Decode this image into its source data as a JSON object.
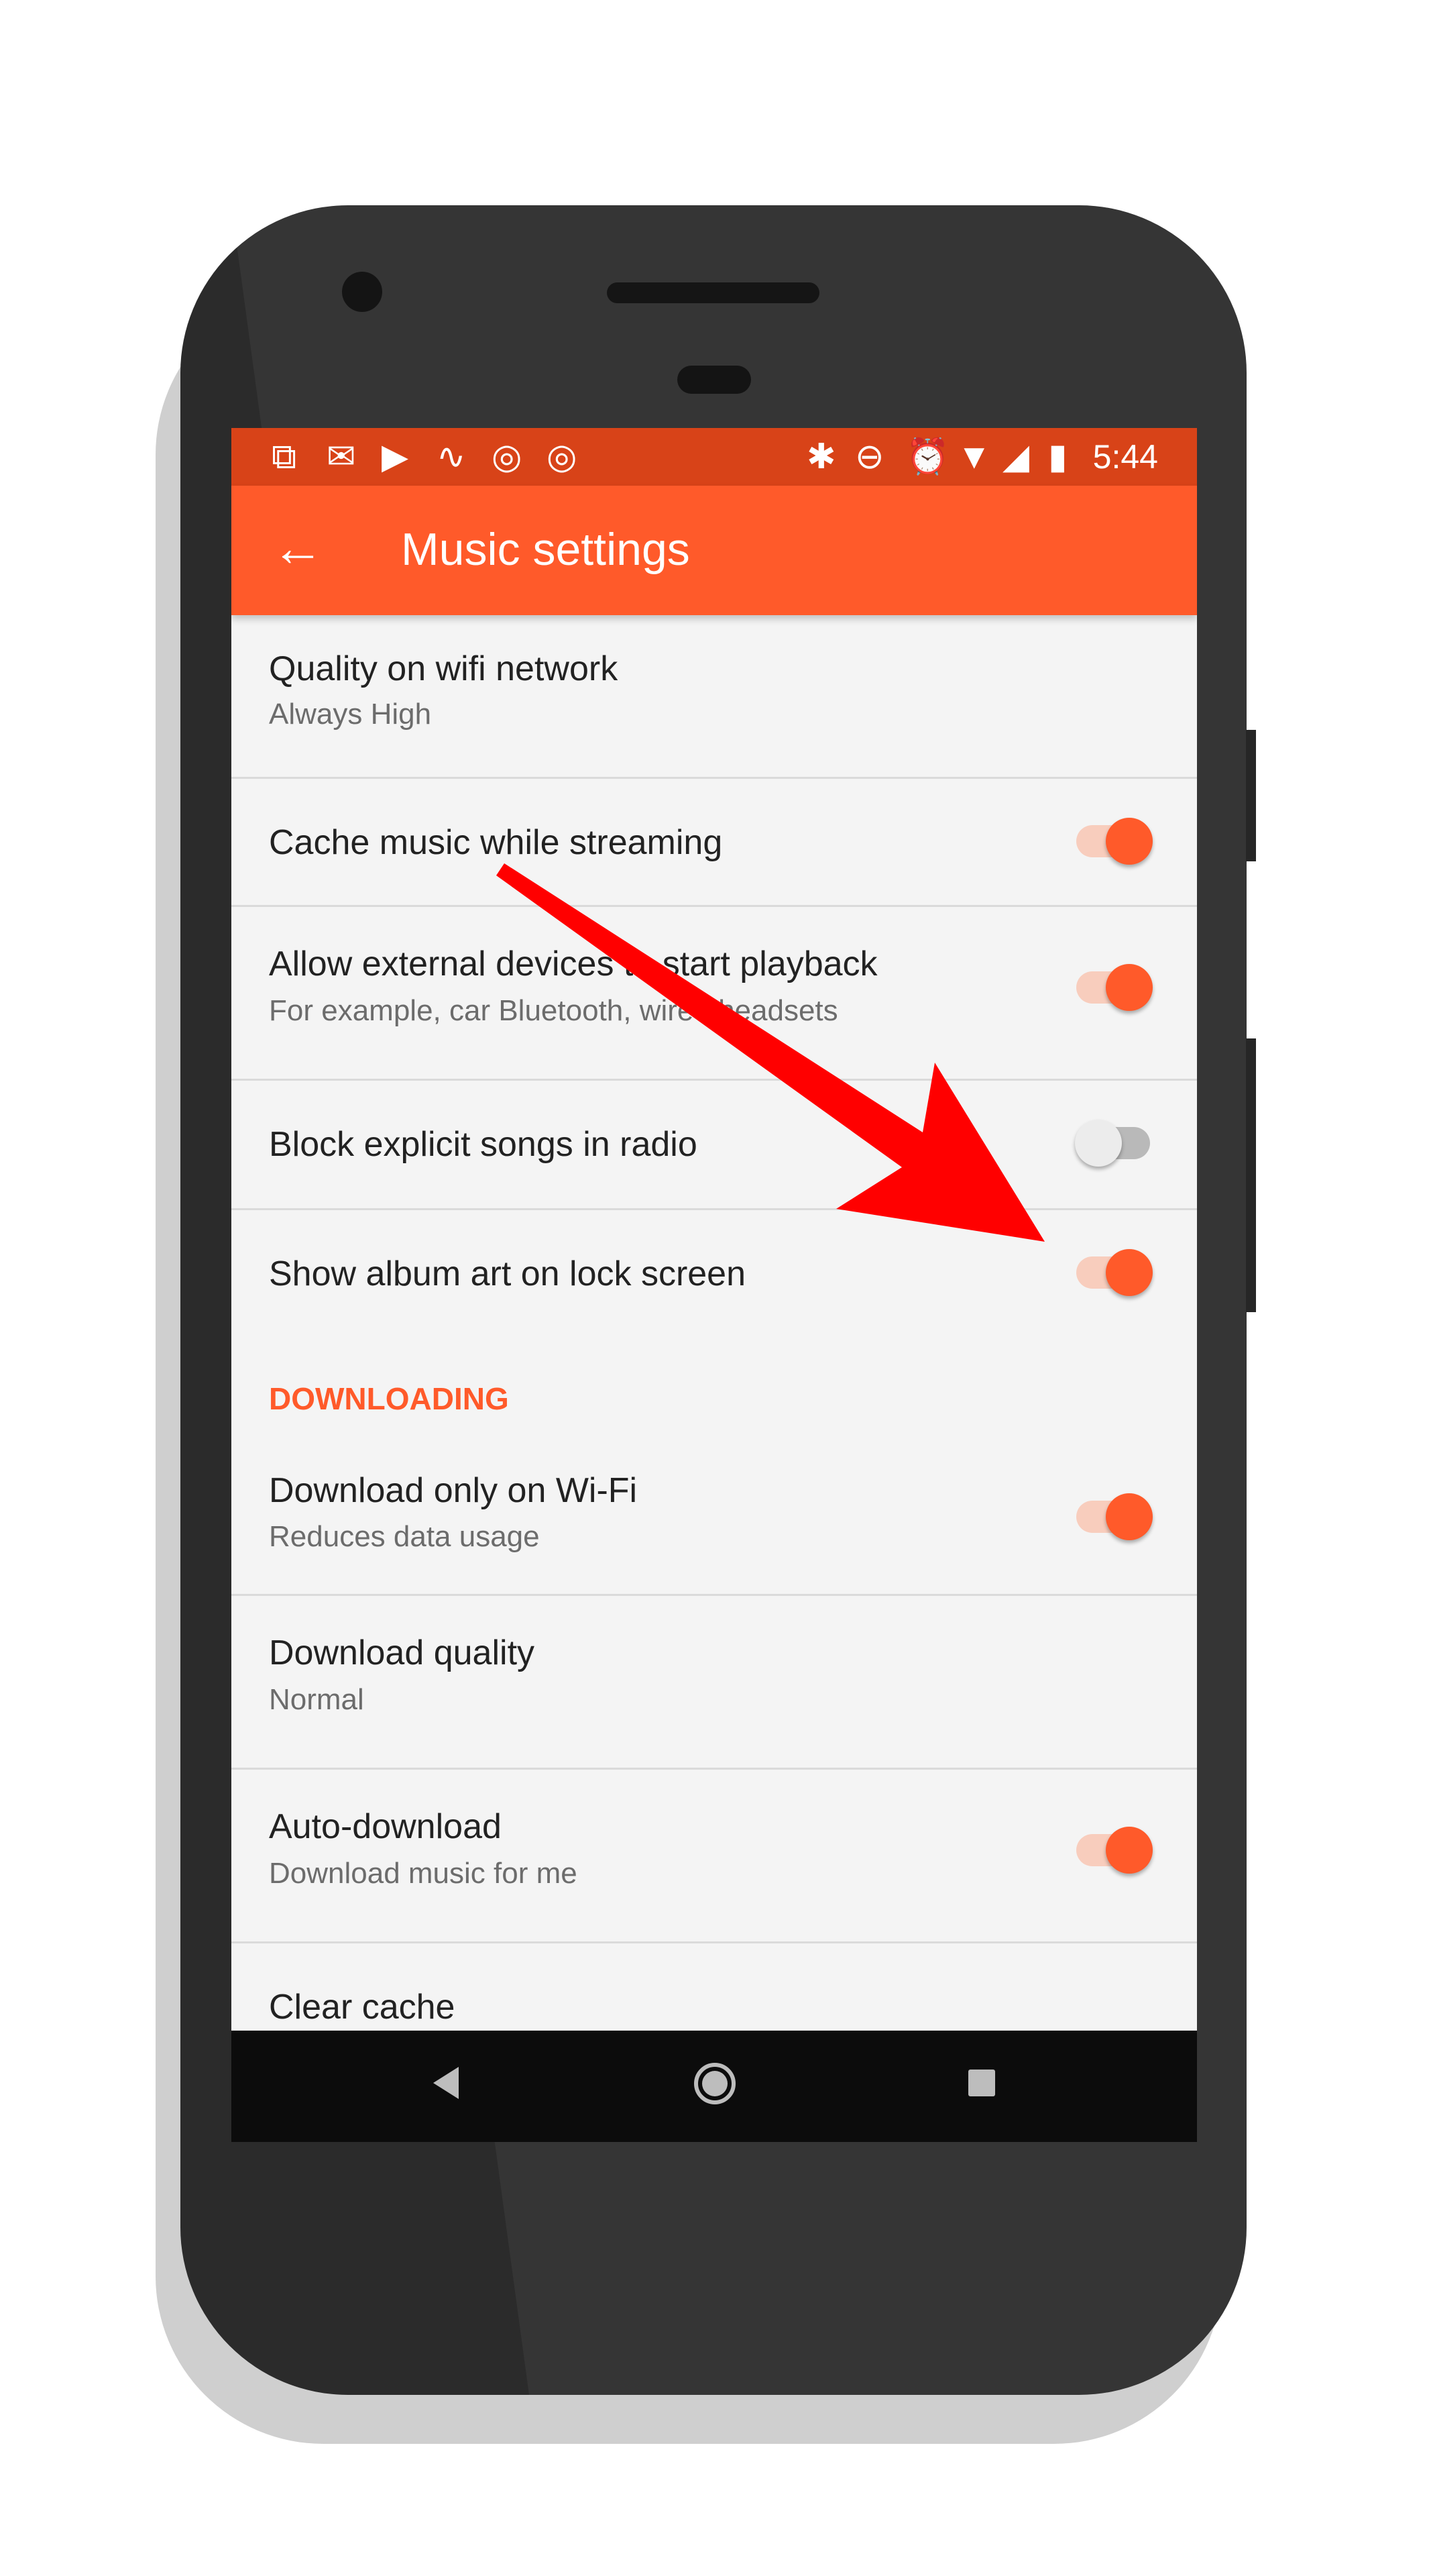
{
  "status_bar": {
    "left_icons": [
      "screenshot-icon",
      "gmail-icon",
      "youtube-icon",
      "analytics-icon",
      "instagram-icon",
      "instagram-icon"
    ],
    "right_icons": [
      "bluetooth-icon",
      "do-not-disturb-icon",
      "alarm-icon",
      "wifi-icon",
      "signal-icon",
      "battery-icon"
    ],
    "time": "5:44"
  },
  "toolbar": {
    "title": "Music settings",
    "back_icon": "arrow-back-icon"
  },
  "settings": [
    {
      "title": "Quality on wifi network",
      "subtitle": "Always High"
    },
    {
      "title": "Cache music while streaming",
      "toggle": true
    },
    {
      "title": "Allow external devices to start playback",
      "subtitle": "For example, car Bluetooth, wired headsets",
      "toggle": true
    },
    {
      "title": "Block explicit songs in radio",
      "toggle": false
    },
    {
      "title": "Show album art on lock screen",
      "toggle": true
    }
  ],
  "downloading": {
    "header": "DOWNLOADING",
    "items": [
      {
        "title": "Download only on Wi-Fi",
        "subtitle": "Reduces data usage",
        "toggle": true
      },
      {
        "title": "Download quality",
        "subtitle": "Normal"
      },
      {
        "title": "Auto-download",
        "subtitle": "Download music for me",
        "toggle": true
      },
      {
        "title": "Clear cache"
      }
    ]
  },
  "colors": {
    "accent": "#ff5a2a",
    "status_bar": "#d84318",
    "annotation_arrow": "#ff0000"
  }
}
